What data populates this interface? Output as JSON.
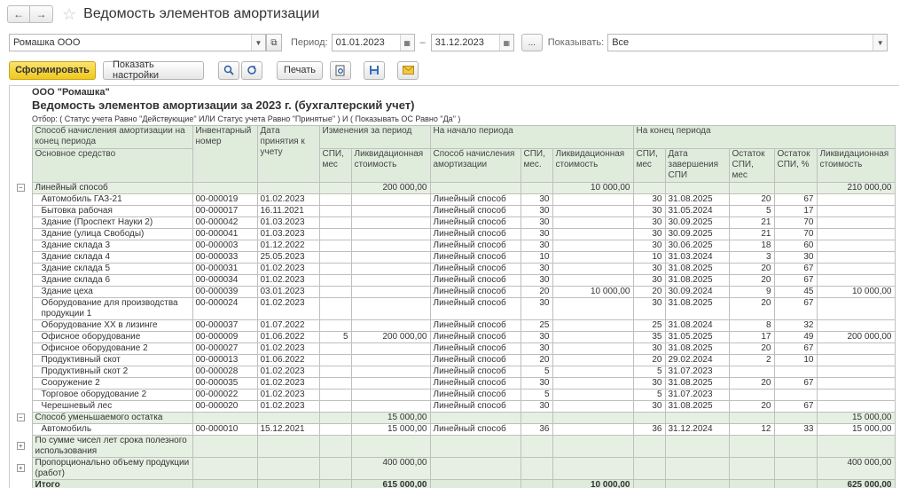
{
  "window": {
    "title": "Ведомость элементов амортизации"
  },
  "nav": {
    "back": "←",
    "forward": "→",
    "star": "☆"
  },
  "filters": {
    "org_value": "Ромашка ООО",
    "period_label": "Период:",
    "date_from": "01.01.2023",
    "dash": "–",
    "date_to": "31.12.2023",
    "ellipsis": "...",
    "show_label": "Показывать:",
    "show_value": "Все"
  },
  "toolbar": {
    "generate": "Сформировать",
    "settings": "Показать настройки",
    "print": "Печать"
  },
  "report": {
    "org": "ООО \"Ромашка\"",
    "title": "Ведомость элементов амортизации за 2023 г. (бухгалтерский учет)",
    "filter": "Отбор: ( Статус учета Равно \"Действующие\" ИЛИ Статус учета Равно \"Принятые\" ) И ( Показывать ОС Равно \"Да\" )",
    "headers": {
      "method_group": "Способ начисления амортизации на конец периода",
      "asset": "Основное средство",
      "inv": "Инвентарный номер",
      "date": "Дата принятия к учету",
      "changes": "Изменения за период",
      "start": "На начало периода",
      "end": "На конец периода",
      "spi": "СПИ, мес",
      "liq": "Ликвидационная стоимость",
      "method": "Способ начисления амортизации",
      "mes": "СПИ, мес.",
      "end_date": "Дата завершения СПИ",
      "rem_mes": "Остаток СПИ, мес",
      "rem_pct": "Остаток СПИ, %"
    },
    "rows": [
      {
        "type": "grp",
        "pm": "−",
        "c": [
          "Линейный способ",
          "",
          "",
          "",
          "200 000,00",
          "",
          "",
          "10 000,00",
          "",
          "",
          "",
          "",
          "210 000,00"
        ]
      },
      {
        "type": "item",
        "c": [
          "Автомобиль ГАЗ-21",
          "00-000019",
          "01.02.2023",
          "",
          "",
          "Линейный способ",
          "30",
          "",
          "30",
          "31.08.2025",
          "20",
          "67",
          ""
        ]
      },
      {
        "type": "item",
        "c": [
          "Бытовка рабочая",
          "00-000017",
          "16.11.2021",
          "",
          "",
          "Линейный способ",
          "30",
          "",
          "30",
          "31.05.2024",
          "5",
          "17",
          ""
        ]
      },
      {
        "type": "item",
        "c": [
          "Здание (Проспект Науки 2)",
          "00-000042",
          "01.03.2023",
          "",
          "",
          "Линейный способ",
          "30",
          "",
          "30",
          "30.09.2025",
          "21",
          "70",
          ""
        ]
      },
      {
        "type": "item",
        "c": [
          "Здание (улица Свободы)",
          "00-000041",
          "01.03.2023",
          "",
          "",
          "Линейный способ",
          "30",
          "",
          "30",
          "30.09.2025",
          "21",
          "70",
          ""
        ]
      },
      {
        "type": "item",
        "c": [
          "Здание склада 3",
          "00-000003",
          "01.12.2022",
          "",
          "",
          "Линейный способ",
          "30",
          "",
          "30",
          "30.06.2025",
          "18",
          "60",
          ""
        ]
      },
      {
        "type": "item",
        "c": [
          "Здание склада 4",
          "00-000033",
          "25.05.2023",
          "",
          "",
          "Линейный способ",
          "10",
          "",
          "10",
          "31.03.2024",
          "3",
          "30",
          ""
        ]
      },
      {
        "type": "item",
        "c": [
          "Здание склада 5",
          "00-000031",
          "01.02.2023",
          "",
          "",
          "Линейный способ",
          "30",
          "",
          "30",
          "31.08.2025",
          "20",
          "67",
          ""
        ]
      },
      {
        "type": "item",
        "c": [
          "Здание склада 6",
          "00-000034",
          "01.02.2023",
          "",
          "",
          "Линейный способ",
          "30",
          "",
          "30",
          "31.08.2025",
          "20",
          "67",
          ""
        ]
      },
      {
        "type": "item",
        "c": [
          "Здание цеха",
          "00-000039",
          "03.01.2023",
          "",
          "",
          "Линейный способ",
          "20",
          "10 000,00",
          "20",
          "30.09.2024",
          "9",
          "45",
          "10 000,00"
        ]
      },
      {
        "type": "item2",
        "c": [
          "Оборудование для производства продукции 1",
          "00-000024",
          "01.02.2023",
          "",
          "",
          "Линейный способ",
          "30",
          "",
          "30",
          "31.08.2025",
          "20",
          "67",
          ""
        ]
      },
      {
        "type": "item",
        "c": [
          "Оборудование ХХ в лизинге",
          "00-000037",
          "01.07.2022",
          "",
          "",
          "Линейный способ",
          "25",
          "",
          "25",
          "31.08.2024",
          "8",
          "32",
          ""
        ]
      },
      {
        "type": "item",
        "c": [
          "Офисное оборудование",
          "00-000009",
          "01.06.2022",
          "5",
          "200 000,00",
          "Линейный способ",
          "30",
          "",
          "35",
          "31.05.2025",
          "17",
          "49",
          "200 000,00"
        ]
      },
      {
        "type": "item",
        "c": [
          "Офисное оборудование 2",
          "00-000027",
          "01.02.2023",
          "",
          "",
          "Линейный способ",
          "30",
          "",
          "30",
          "31.08.2025",
          "20",
          "67",
          ""
        ]
      },
      {
        "type": "item",
        "c": [
          "Продуктивный скот",
          "00-000013",
          "01.06.2022",
          "",
          "",
          "Линейный способ",
          "20",
          "",
          "20",
          "29.02.2024",
          "2",
          "10",
          ""
        ]
      },
      {
        "type": "item",
        "c": [
          "Продуктивный скот 2",
          "00-000028",
          "01.02.2023",
          "",
          "",
          "Линейный способ",
          "5",
          "",
          "5",
          "31.07.2023",
          "",
          "",
          ""
        ]
      },
      {
        "type": "item",
        "c": [
          "Сооружение 2",
          "00-000035",
          "01.02.2023",
          "",
          "",
          "Линейный способ",
          "30",
          "",
          "30",
          "31.08.2025",
          "20",
          "67",
          ""
        ]
      },
      {
        "type": "item",
        "c": [
          "Торговое оборудование 2",
          "00-000022",
          "01.02.2023",
          "",
          "",
          "Линейный способ",
          "5",
          "",
          "5",
          "31.07.2023",
          "",
          "",
          ""
        ]
      },
      {
        "type": "item",
        "c": [
          "Черешневый лес",
          "00-000020",
          "01.02.2023",
          "",
          "",
          "Линейный способ",
          "30",
          "",
          "30",
          "31.08.2025",
          "20",
          "67",
          ""
        ]
      },
      {
        "type": "grp",
        "pm": "−",
        "c": [
          "Способ уменьшаемого остатка",
          "",
          "",
          "",
          "15 000,00",
          "",
          "",
          "",
          "",
          "",
          "",
          "",
          "15 000,00"
        ]
      },
      {
        "type": "item",
        "c": [
          "Автомобиль",
          "00-000010",
          "15.12.2021",
          "",
          "15 000,00",
          "Линейный способ",
          "36",
          "",
          "36",
          "31.12.2024",
          "12",
          "33",
          "15 000,00"
        ]
      },
      {
        "type": "grp2",
        "pm": "+",
        "c": [
          "По сумме чисел лет срока полезного использования",
          "",
          "",
          "",
          "",
          "",
          "",
          "",
          "",
          "",
          "",
          "",
          ""
        ]
      },
      {
        "type": "grp2",
        "pm": "+",
        "c": [
          "Пропорционально объему продукции (работ)",
          "",
          "",
          "",
          "400 000,00",
          "",
          "",
          "",
          "",
          "",
          "",
          "",
          "400 000,00"
        ]
      },
      {
        "type": "tot",
        "c": [
          "Итого",
          "",
          "",
          "",
          "615 000,00",
          "",
          "",
          "10 000,00",
          "",
          "",
          "",
          "",
          "625 000,00"
        ]
      }
    ]
  }
}
